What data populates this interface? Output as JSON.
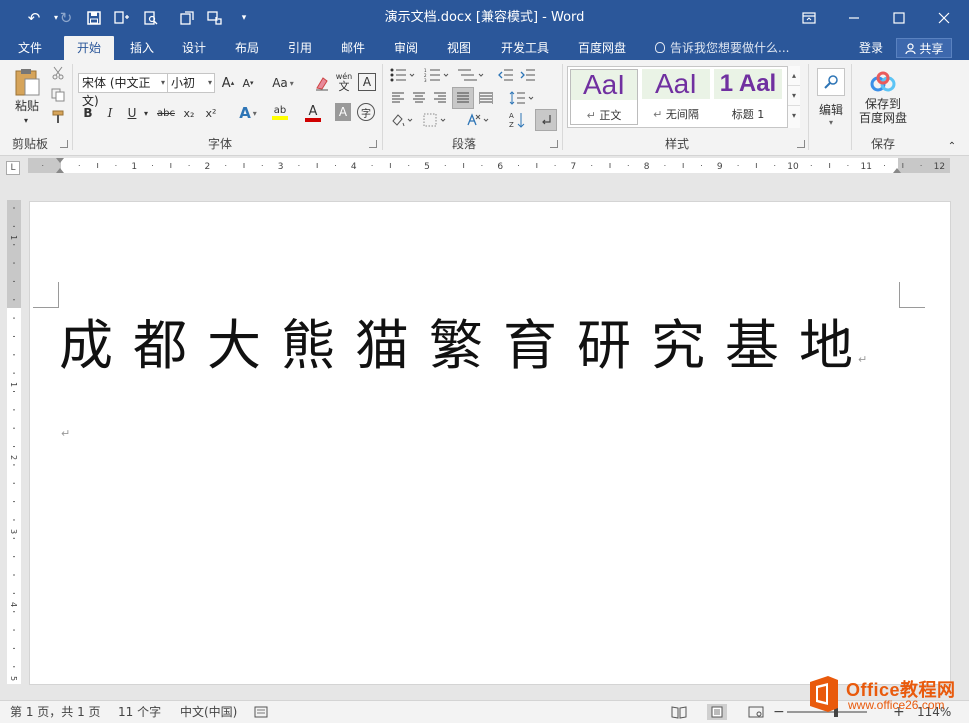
{
  "window": {
    "title": "演示文档.docx [兼容模式] - Word",
    "min_glyph": "—",
    "max_glyph": "☐",
    "close_glyph": "✕",
    "ribbon_opts_glyph": "⧉"
  },
  "tabs": [
    "文件",
    "开始",
    "插入",
    "设计",
    "布局",
    "引用",
    "邮件",
    "审阅",
    "视图",
    "开发工具",
    "百度网盘"
  ],
  "active_tab": "开始",
  "tell_me": "告诉我您想要做什么...",
  "login": "登录",
  "share": "共享",
  "ribbon": {
    "clipboard": {
      "label": "剪贴板",
      "paste": "粘贴"
    },
    "font": {
      "label": "字体",
      "font_name": "宋体 (中文正文)",
      "font_size": "小初",
      "grow": "A",
      "shrink": "A",
      "case": "Aa",
      "bold": "B",
      "italic": "I",
      "underline": "U",
      "strike": "abc",
      "sub": "x₂",
      "sup": "x²",
      "phonetic": "wén",
      "phonetic2": "文",
      "border": "A",
      "effects": "A",
      "highlight": "ab",
      "font_color": "A",
      "shading": "A",
      "encircle": "字"
    },
    "paragraph": {
      "label": "段落"
    },
    "styles": {
      "label": "样式",
      "items": [
        {
          "sample": "AaI",
          "name": "正文"
        },
        {
          "sample": "AaI",
          "name": "无间隔"
        },
        {
          "sample": "1 Aal",
          "name": "标题 1"
        }
      ]
    },
    "editing": {
      "label": "编辑"
    },
    "save": {
      "label": "保存",
      "line1": "保存到",
      "line2": "百度网盘"
    }
  },
  "ruler": {
    "numbers": [
      "1",
      "2",
      "3",
      "4",
      "5",
      "6",
      "7",
      "8",
      "9",
      "10",
      "11",
      "12"
    ],
    "vnumbers": [
      "1",
      "1",
      "2",
      "3",
      "4",
      "5"
    ]
  },
  "document": {
    "heading": "成都大熊猫繁育研究基地",
    "para_mark": "↵"
  },
  "status": {
    "page": "第 1 页，共 1 页",
    "words": "11 个字",
    "lang": "中文(中国)",
    "zoom": "114%"
  },
  "watermark": {
    "line1": "Office教程网",
    "line2": "www.office26.com"
  },
  "colors": {
    "word_blue": "#2b579a",
    "style_purple": "#7030a0",
    "watermark_orange": "#e95a0c"
  }
}
